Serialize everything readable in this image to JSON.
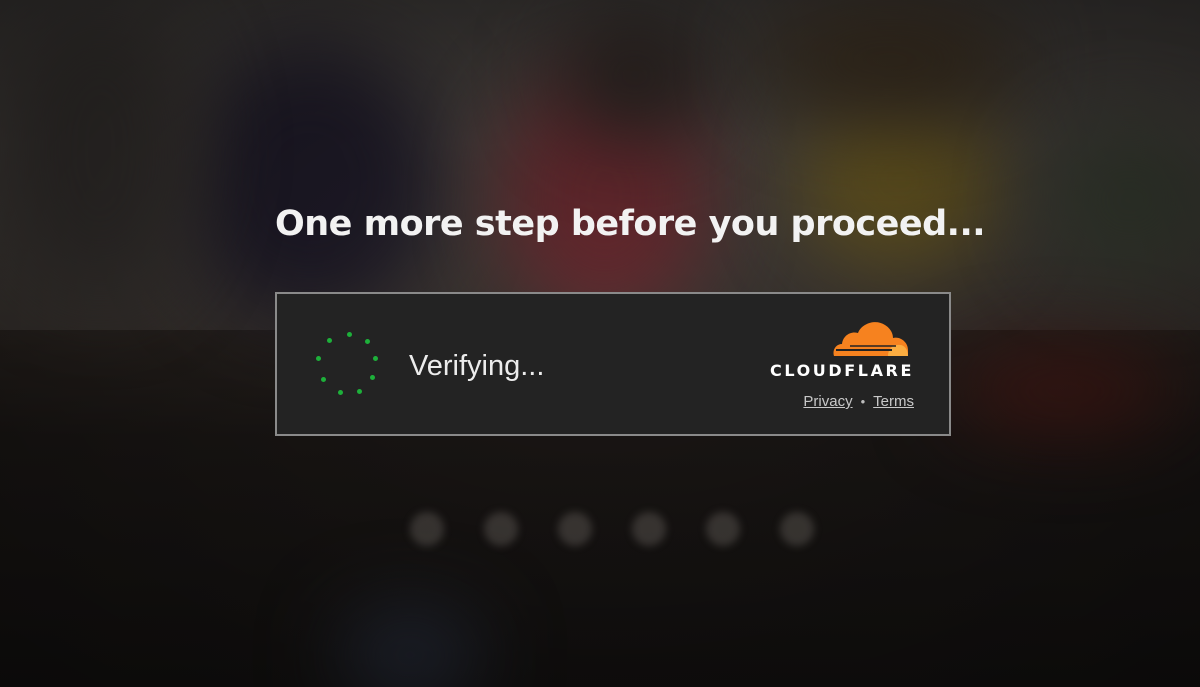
{
  "heading": "One more step before you proceed...",
  "widget": {
    "status": "Verifying...",
    "spinner_icon": "loading-spinner-icon",
    "spinner_color": "#1db03a",
    "brand": {
      "icon": "cloudflare-cloud-icon",
      "wordmark": "CLOUDFLARE",
      "accent": "#f6821f"
    },
    "links": {
      "privacy": "Privacy",
      "separator": "•",
      "terms": "Terms"
    }
  },
  "carousel": {
    "dot_count": 6
  }
}
